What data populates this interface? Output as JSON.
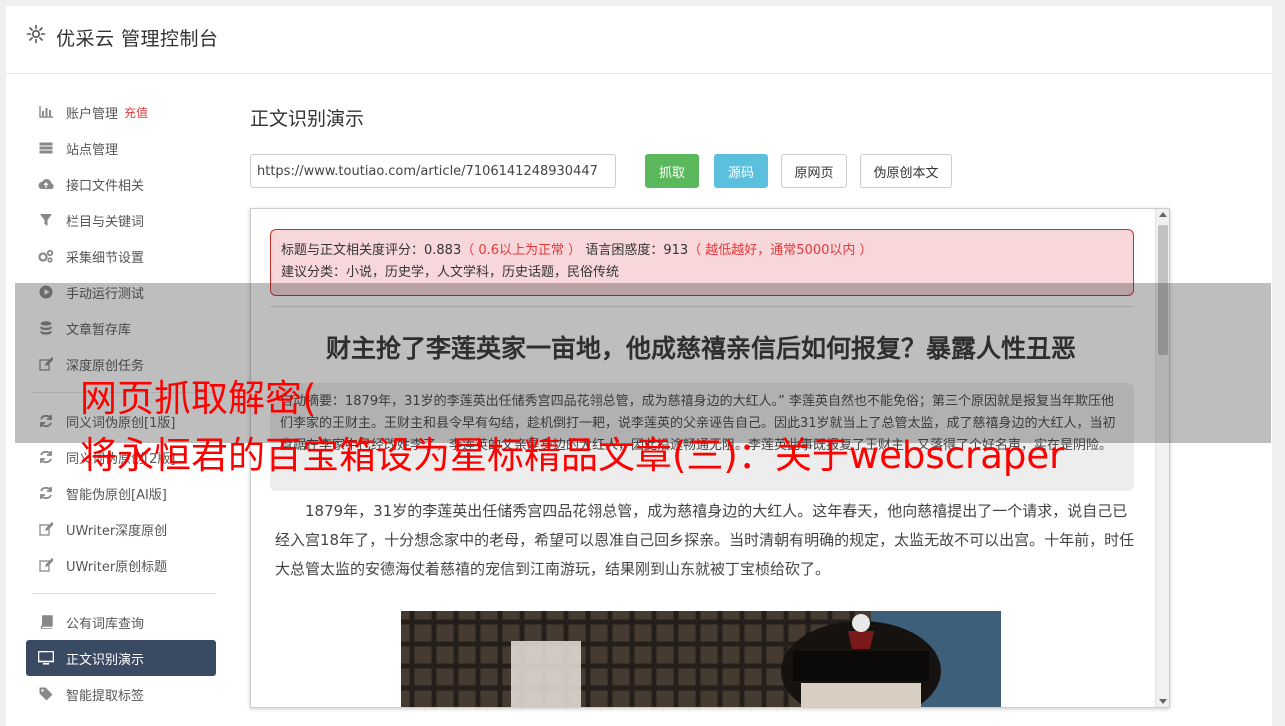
{
  "header": {
    "title": "优采云 管理控制台"
  },
  "sidebar": {
    "items": [
      {
        "label": "账户管理",
        "badge": "充值",
        "icon": "bar-chart-icon"
      },
      {
        "label": "站点管理",
        "icon": "server-icon"
      },
      {
        "label": "接口文件相关",
        "icon": "cloud-upload-icon"
      },
      {
        "label": "栏目与关键词",
        "icon": "filter-icon"
      },
      {
        "label": "采集细节设置",
        "icon": "gears-icon"
      },
      {
        "label": "手动运行测试",
        "icon": "play-circle-icon"
      },
      {
        "label": "文章暂存库",
        "icon": "database-icon"
      },
      {
        "label": "深度原创任务",
        "icon": "edit-icon"
      },
      {
        "label": "同义词伪原创[1版]",
        "icon": "refresh-icon"
      },
      {
        "label": "同义词伪原创[2版]",
        "icon": "refresh-icon"
      },
      {
        "label": "智能伪原创[AI版]",
        "icon": "refresh-icon"
      },
      {
        "label": "UWriter深度原创",
        "icon": "edit-icon"
      },
      {
        "label": "UWriter原创标题",
        "icon": "edit-icon"
      },
      {
        "label": "公有词库查询",
        "icon": "book-icon"
      },
      {
        "label": "正文识别演示",
        "icon": "monitor-icon"
      },
      {
        "label": "智能提取标签",
        "icon": "tag-icon"
      }
    ]
  },
  "main": {
    "title": "正文识别演示",
    "url_value": "https://www.toutiao.com/article/7106141248930447",
    "buttons": {
      "grab": "抓取",
      "source": "源码",
      "original": "原网页",
      "pseudo": "伪原创本文"
    }
  },
  "panel": {
    "alert": {
      "score_label": "标题与正文相关度评分：0.883",
      "score_note": "（ 0.6以上为正常 ）",
      "perplexity_label": "语言困惑度：913",
      "perplexity_note": "（ 越低越好，通常5000以内 ）",
      "category": "建议分类：小说，历史学，人文学科，历史话题，民俗传统"
    },
    "article_title": "财主抢了李莲英家一亩地，他成慈禧亲信后如何报复？暴露人性丑恶",
    "summary": "自动摘要：1879年，31岁的李莲英出任储秀宫四品花翎总管，成为慈禧身边的大红人。” 李莲英自然也不能免俗；第三个原因就是报复当年欺压他们李家的王财主。王财主和县令早有勾结，趁机倒打一耙，说李莲英的父亲诬告自己。因此31岁就当上了总管太监，成了慈禧身边的大红人，当初盘踞在李家中已经改姓李了，李莲英的父亲是身边的大红人，因此沿途畅通无阻。李莲英此事既报复了王财主，又落得了个好名声，实在是阴险。",
    "paragraph": "1879年，31岁的李莲英出任储秀宫四品花翎总管，成为慈禧身边的大红人。这年春天，他向慈禧提出了一个请求，说自己已经入宫18年了，十分想念家中的老母，希望可以恩准自己回乡探亲。当时清朝有明确的规定，太监无故不可以出宫。十年前，时任大总管太监的安德海仗着慈禧的宠信到江南游玩，结果刚到山东就被丁宝桢给砍了。"
  },
  "overlay": {
    "line1": "网页抓取解密(",
    "line2": "将永恒君的百宝箱设为星标精品文章(三)：关于webscraper"
  }
}
